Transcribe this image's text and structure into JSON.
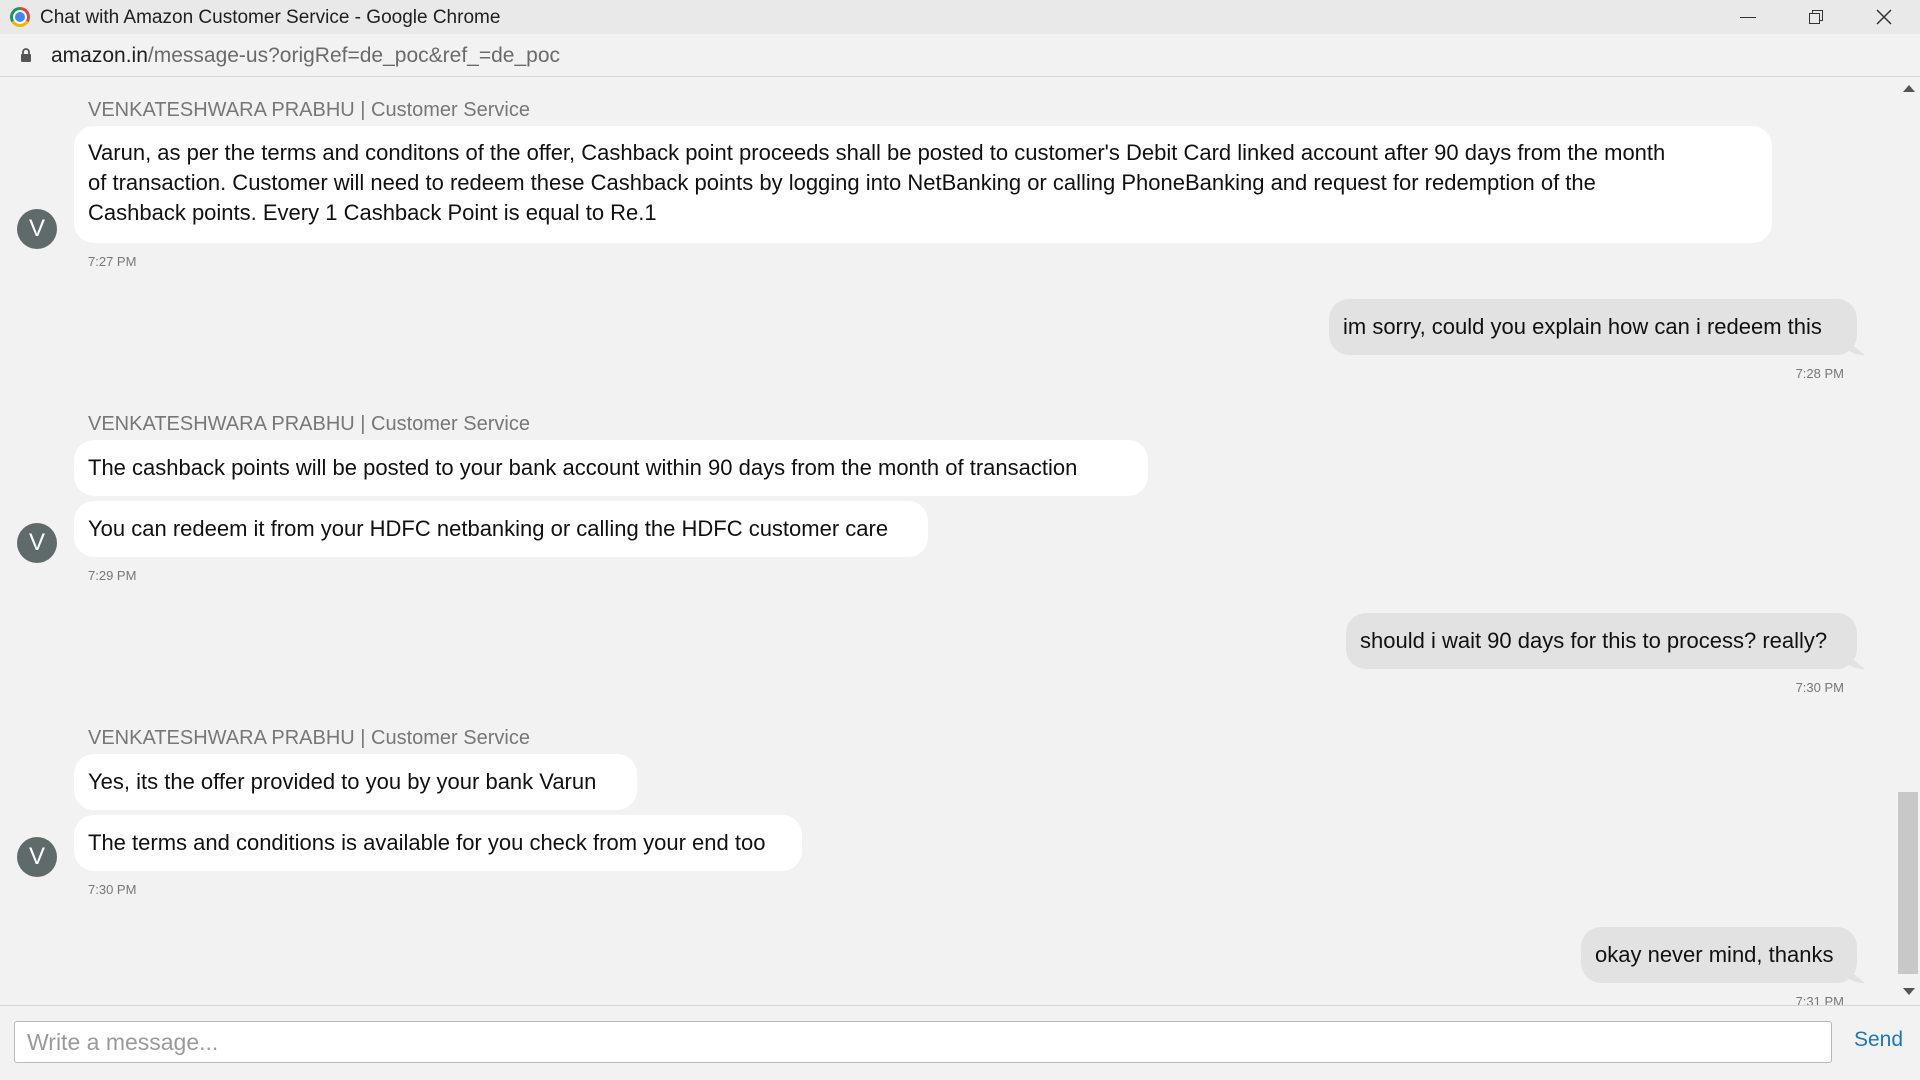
{
  "window": {
    "title": "Chat with Amazon Customer Service - Google Chrome"
  },
  "address": {
    "domain": "amazon.in",
    "path": "/message-us?origRef=de_poc&ref_=de_poc"
  },
  "agent": {
    "initial": "V",
    "label": "VENKATESHWARA PRABHU | Customer Service"
  },
  "messages": {
    "g1": {
      "lines": [
        "Varun, as per the terms and conditons of the offer, Cashback point proceeds shall be posted to customer's Debit Card linked account after 90 days from the month",
        "of transaction. Customer will need to redeem these Cashback points by logging into NetBanking or calling PhoneBanking and request for redemption of the",
        "Cashback points. Every 1 Cashback Point is equal to Re.1"
      ],
      "time": "7:27 PM"
    },
    "u1": {
      "text": "im sorry, could you explain how can i redeem this",
      "time": "7:28 PM"
    },
    "g2": {
      "texts": [
        "The cashback points will be posted to your bank account within 90 days from the month of transaction",
        "You can redeem it from your HDFC netbanking or calling the HDFC customer care"
      ],
      "time": "7:29 PM"
    },
    "u2": {
      "text": "should i wait 90 days for this to process? really?",
      "time": "7:30 PM"
    },
    "g3": {
      "texts": [
        "Yes, its the offer provided to you by your bank Varun",
        "The terms and conditions is available for you check from your end too"
      ],
      "time": "7:30 PM"
    },
    "u3": {
      "text": "okay never mind, thanks",
      "time": "7:31 PM"
    }
  },
  "composer": {
    "placeholder": "Write a message...",
    "send_label": "Send"
  },
  "icons": {
    "browser": "chrome-logo-icon",
    "lock": "lock-icon",
    "minimize": "minimize-icon",
    "maximize": "maximize-icon",
    "close": "close-icon"
  }
}
